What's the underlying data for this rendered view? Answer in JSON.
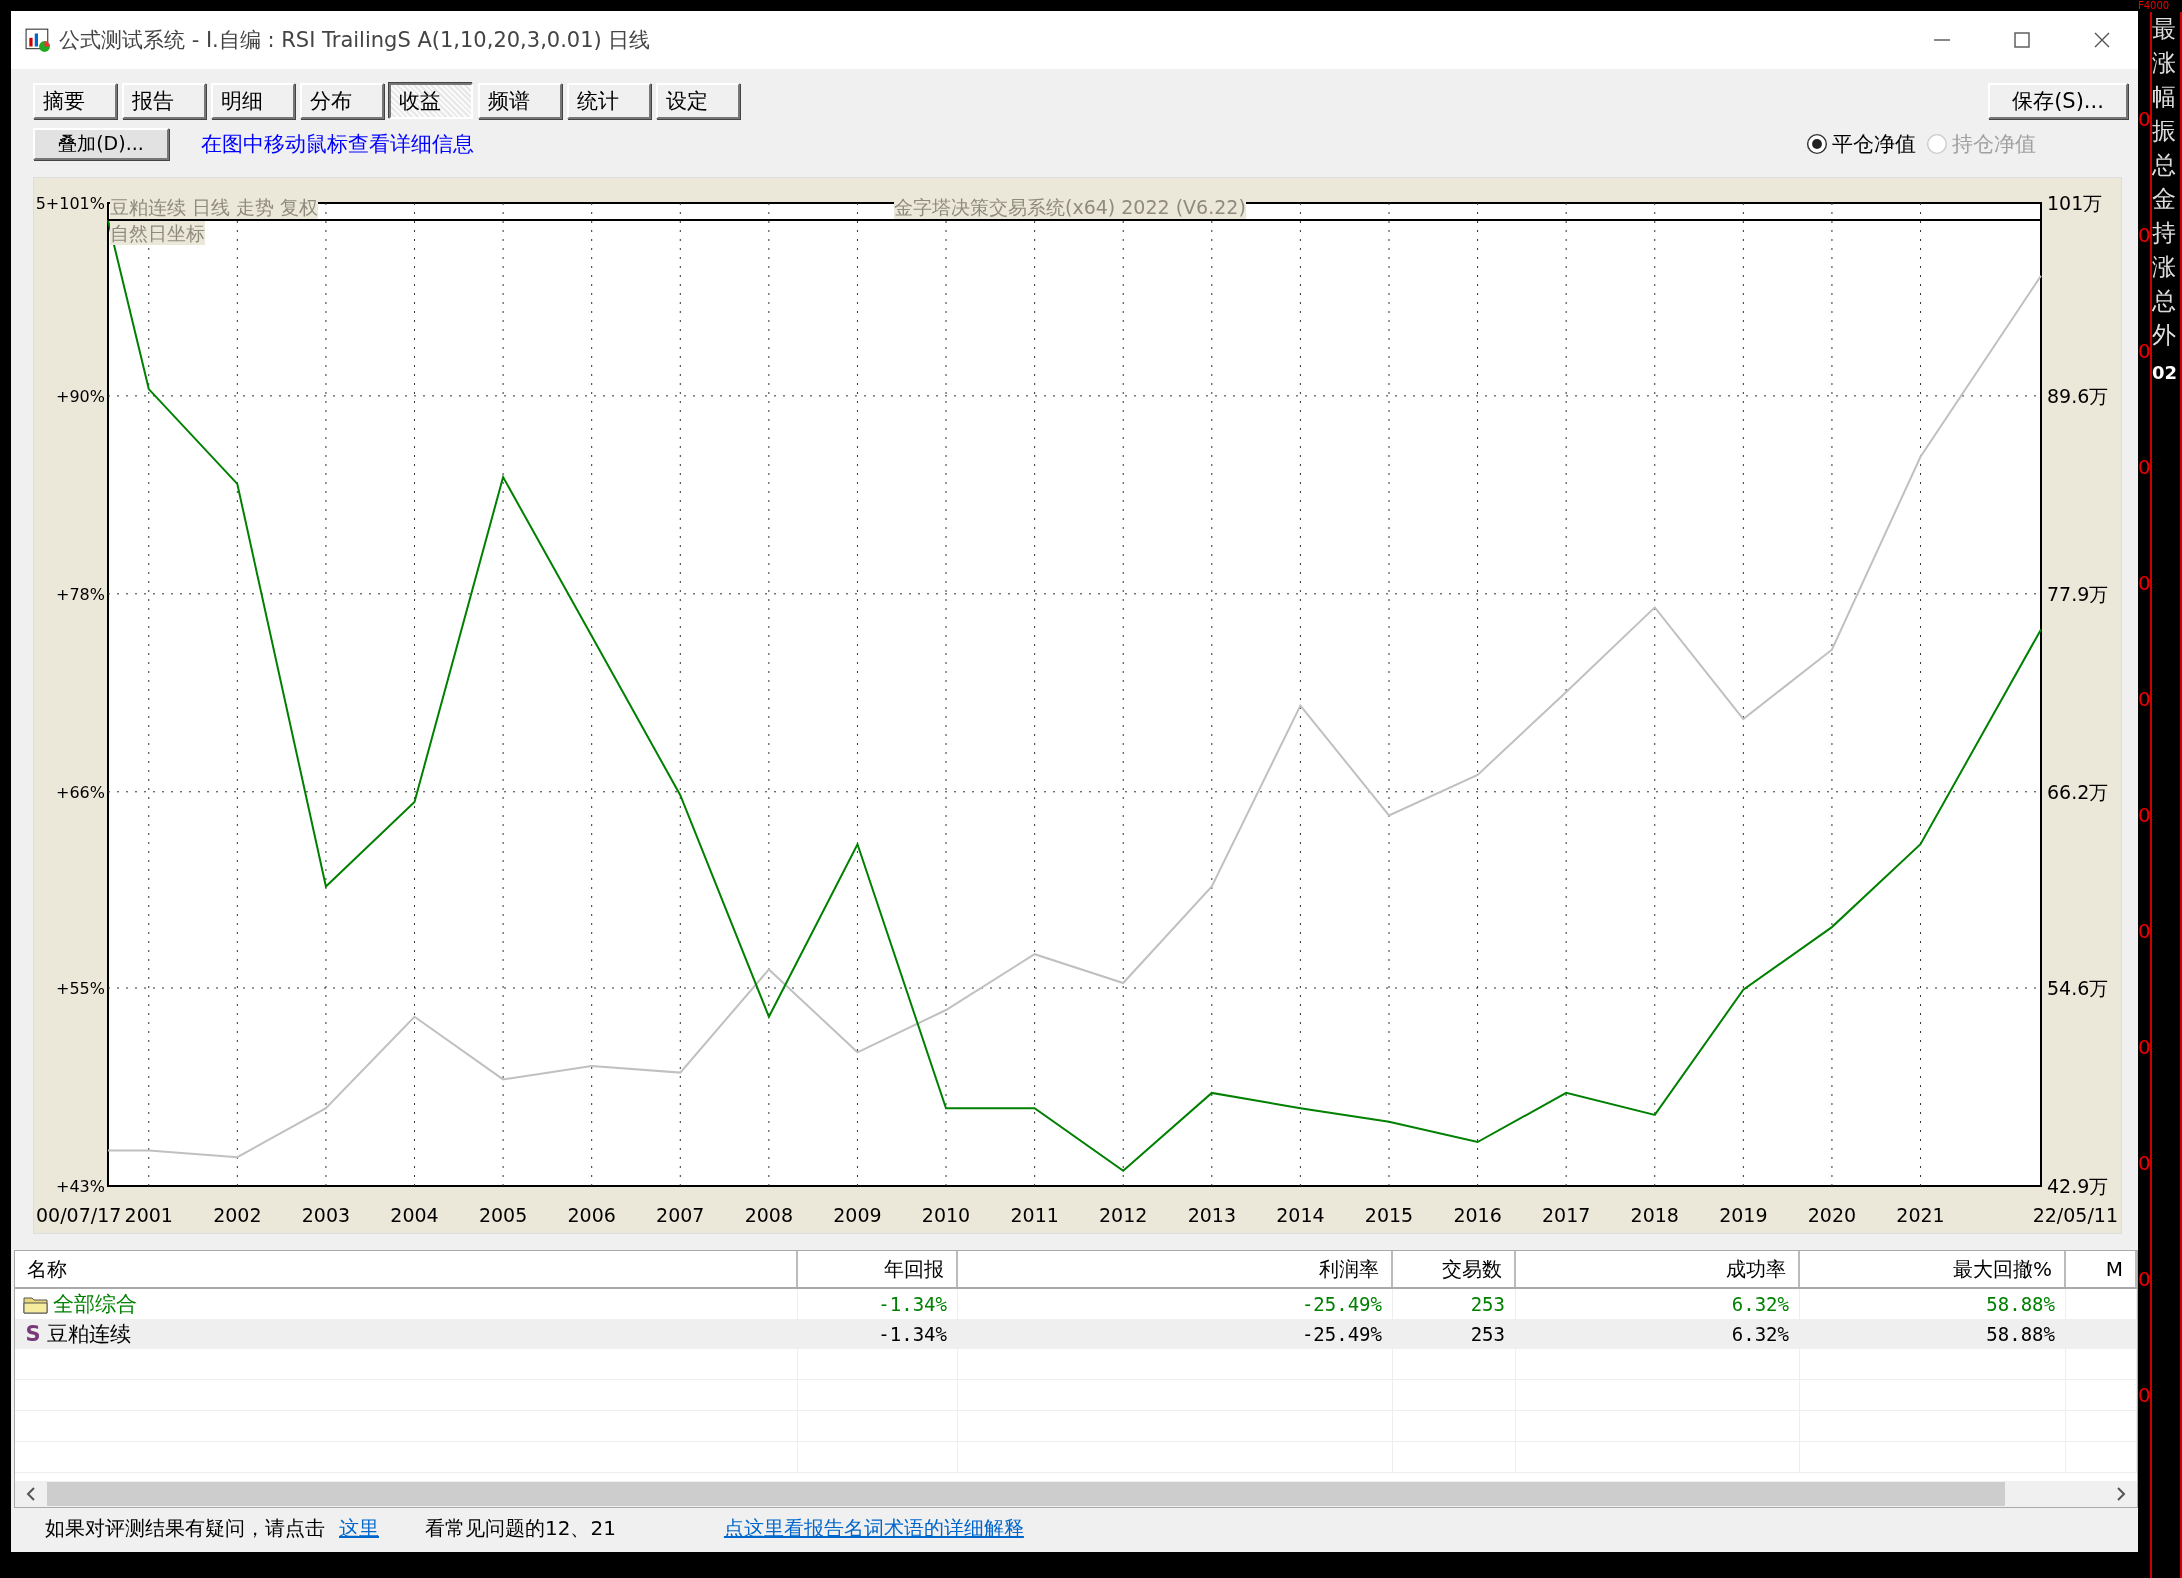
{
  "window": {
    "title": "公式测试系统 - I.自编 : RSI TrailingS A(1,10,20,3,0.01) 日线"
  },
  "tabs": [
    {
      "label": "摘要",
      "selected": false
    },
    {
      "label": "报告",
      "selected": false
    },
    {
      "label": "明细",
      "selected": false
    },
    {
      "label": "分布",
      "selected": false
    },
    {
      "label": "收益",
      "selected": true
    },
    {
      "label": "频谱",
      "selected": false
    },
    {
      "label": "统计",
      "selected": false
    },
    {
      "label": "设定",
      "selected": false
    }
  ],
  "save_button": "保存(S)...",
  "overlay_button": "叠加(D)...",
  "hint": "在图中移动鼠标查看详细信息",
  "radios": [
    {
      "label": "平仓净值",
      "selected": true,
      "disabled": false
    },
    {
      "label": "持仓净值",
      "selected": false,
      "disabled": true
    }
  ],
  "chart": {
    "captions": [
      "豆粕连续 日线 走势 复权",
      "自然日坐标",
      "金字塔决策交易系统(x64) 2022 (V6.22)"
    ],
    "start_date": "00/07/17",
    "end_date": "22/05/11",
    "right_axis_labels": [
      "101万",
      "89.6万",
      "77.9万",
      "66.2万",
      "54.6万",
      "42.9万"
    ],
    "chart_data": {
      "type": "line",
      "x": [
        2000.54,
        2001,
        2002,
        2003,
        2004,
        2005,
        2006,
        2007,
        2008,
        2009,
        2010,
        2011,
        2012,
        2013,
        2014,
        2015,
        2016,
        2017,
        2018,
        2019,
        2020,
        2021,
        2022.36
      ],
      "xlim": [
        2000.54,
        2022.36
      ],
      "ylim": [
        42.9,
        101
      ],
      "grid": true,
      "xticks": [
        2001,
        2002,
        2003,
        2004,
        2005,
        2006,
        2007,
        2008,
        2009,
        2010,
        2011,
        2012,
        2013,
        2014,
        2015,
        2016,
        2017,
        2018,
        2019,
        2020,
        2021
      ],
      "yticks": [
        {
          "value": 101,
          "label": "5+101%"
        },
        {
          "value": 89.6,
          "label": "+90%"
        },
        {
          "value": 77.9,
          "label": "+78%"
        },
        {
          "value": 66.2,
          "label": "+66%"
        },
        {
          "value": 54.6,
          "label": "+55%"
        },
        {
          "value": 42.9,
          "label": "+43%"
        }
      ],
      "series": [
        {
          "color": "#008000",
          "values": [
            100,
            90,
            84.4,
            60.6,
            65.6,
            84.8,
            75.4,
            66,
            52.9,
            63.1,
            47.5,
            47.5,
            43.8,
            48.4,
            47.5,
            46.7,
            45.5,
            48.4,
            47.1,
            54.5,
            58.2,
            63.1,
            75.8
          ]
        },
        {
          "color": "#c0c0c0",
          "values": [
            45,
            45,
            44.6,
            47.5,
            52.9,
            49.2,
            50,
            49.6,
            55.7,
            50.8,
            53.3,
            56.6,
            54.9,
            60.6,
            71.3,
            64.8,
            67.2,
            72.1,
            77.1,
            70.5,
            74.6,
            86,
            96.7
          ]
        }
      ]
    }
  },
  "table": {
    "columns": [
      "名称",
      "年回报",
      "利润率",
      "交易数",
      "成功率",
      "最大回撤%",
      "M"
    ],
    "rows": [
      {
        "kind": "group",
        "cells": [
          "全部综合",
          "-1.34%",
          "-25.49%",
          "253",
          "6.32%",
          "58.88%"
        ],
        "selected": false
      },
      {
        "kind": "symbol",
        "badge": "S",
        "cells": [
          "豆粕连续",
          "-1.34%",
          "-25.49%",
          "253",
          "6.32%",
          "58.88%"
        ],
        "selected": true
      }
    ]
  },
  "status_bar": {
    "text": "如果对评测结果有疑问，请点击",
    "link": "这里",
    "note": "看常见问题的12、21",
    "help_link": "点这里看报告名词术语的详细解释"
  },
  "background_app": {
    "top_label": "F4000",
    "side_labels": [
      "最",
      "涨",
      "幅",
      "振",
      "总",
      "金",
      "持",
      "涨",
      "总",
      "外"
    ],
    "code": "02",
    "scale_marks": [
      "0",
      "0",
      "0",
      "0",
      "0",
      "0",
      "0",
      "0",
      "0",
      "0",
      "0",
      "0"
    ]
  }
}
